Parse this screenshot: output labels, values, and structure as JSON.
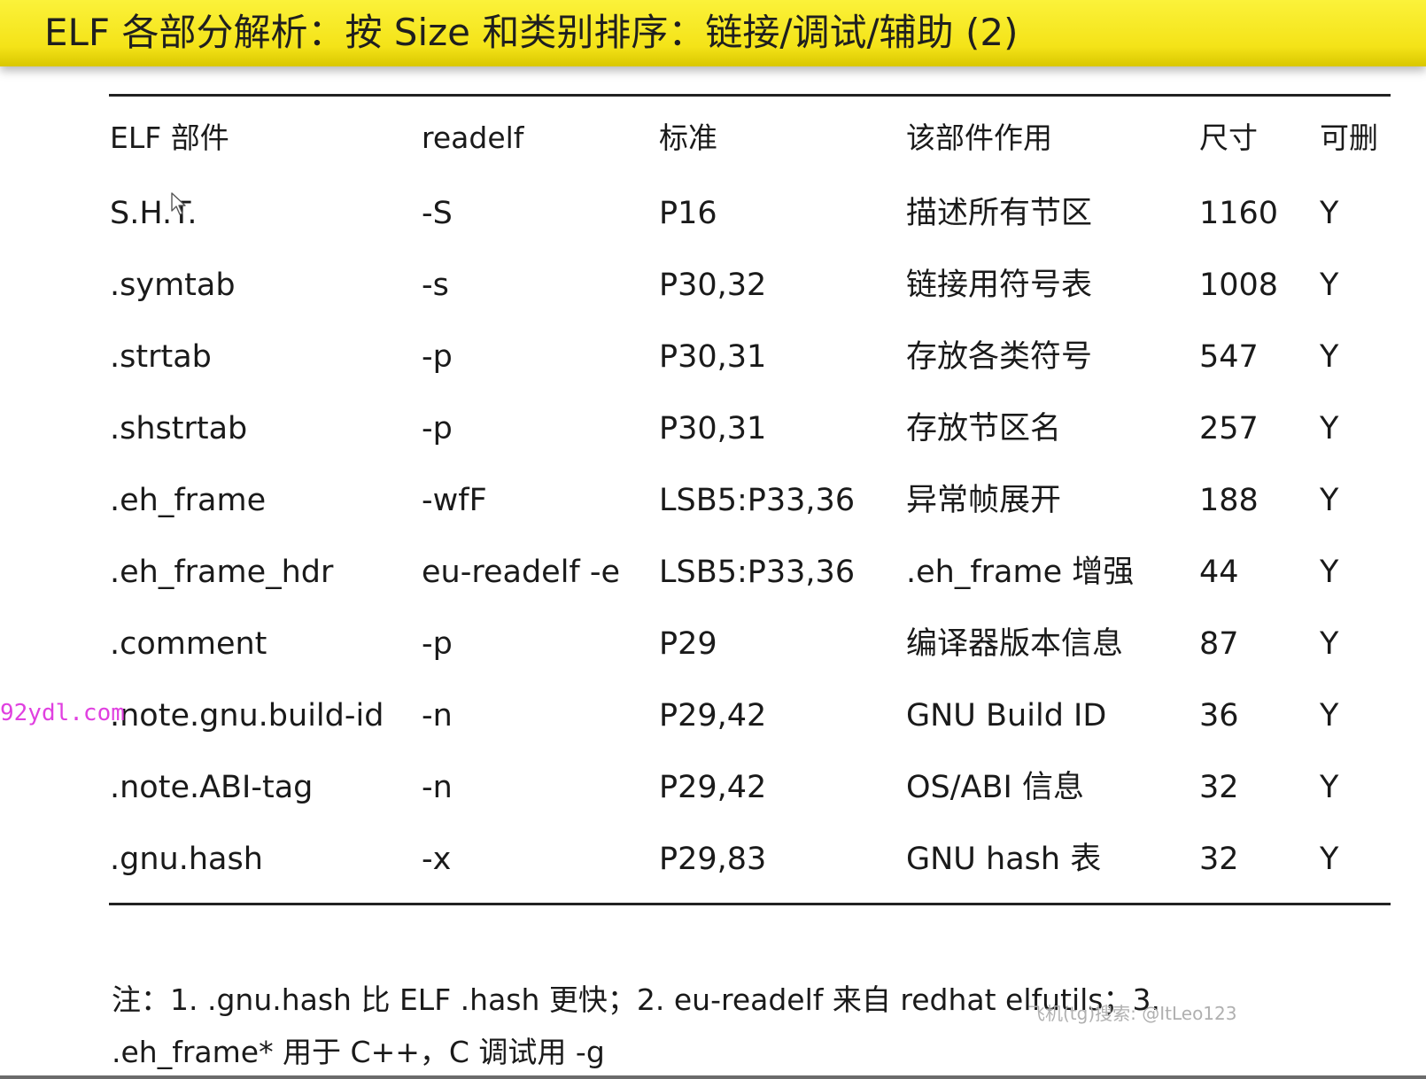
{
  "title": "ELF 各部分解析：按 Size 和类别排序：链接/调试/辅助 (2)",
  "table": {
    "headers": [
      "ELF 部件",
      "readelf",
      "标准",
      "该部件作用",
      "尺寸",
      "可删"
    ],
    "rows": [
      [
        "S.H.T.",
        "-S",
        "P16",
        "描述所有节区",
        "1160",
        "Y"
      ],
      [
        ".symtab",
        "-s",
        "P30,32",
        "链接用符号表",
        "1008",
        "Y"
      ],
      [
        ".strtab",
        "-p",
        "P30,31",
        "存放各类符号",
        "547",
        "Y"
      ],
      [
        ".shstrtab",
        "-p",
        "P30,31",
        "存放节区名",
        "257",
        "Y"
      ],
      [
        ".eh_frame",
        "-wfF",
        "LSB5:P33,36",
        "异常帧展开",
        "188",
        "Y"
      ],
      [
        ".eh_frame_hdr",
        "eu-readelf -e",
        "LSB5:P33,36",
        ".eh_frame 增强",
        "44",
        "Y"
      ],
      [
        ".comment",
        "-p",
        "P29",
        "编译器版本信息",
        "87",
        "Y"
      ],
      [
        ".note.gnu.build-id",
        "-n",
        "P29,42",
        "GNU Build ID",
        "36",
        "Y"
      ],
      [
        ".note.ABI-tag",
        "-n",
        "P29,42",
        "OS/ABI 信息",
        "32",
        "Y"
      ],
      [
        ".gnu.hash",
        "-x",
        "P29,83",
        "GNU hash 表",
        "32",
        "Y"
      ]
    ]
  },
  "note_line1": "注：1. .gnu.hash 比 ELF .hash 更快；2. eu-readelf 来自 redhat elfutils；3.",
  "note_line2": ".eh_frame* 用于 C++，C 调试用 -g",
  "watermark": "92ydl.com",
  "overlay_handle": "飞机(tg)搜索: @ItLeo123",
  "colors": {
    "title_bar": "#f4e318",
    "watermark": "#e040e0"
  }
}
